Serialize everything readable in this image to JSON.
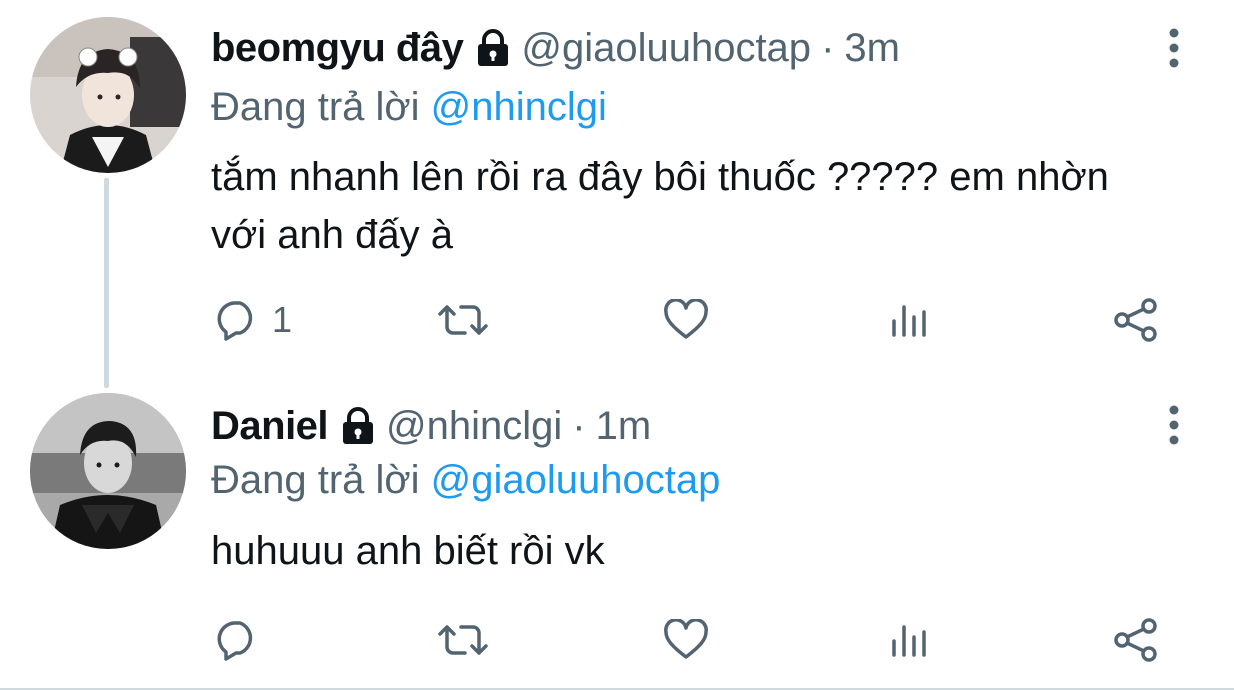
{
  "thread": [
    {
      "display_name": "beomgyu đây",
      "handle": "@giaoluuhoctap",
      "separator": "·",
      "time": "3m",
      "replying_prefix": "Đang trả lời",
      "replying_to": "@nhinclgi",
      "text": "tắm nhanh lên rồi ra đây bôi thuốc ????? em nhờn với anh đấy à",
      "reply_count": "1",
      "avatar_colors": {
        "bg": "#d9d4d0",
        "hair": "#2b2424",
        "face": "#f1e4da",
        "shirt": "#1b1b1b"
      }
    },
    {
      "display_name": "Daniel",
      "handle": "@nhinclgi",
      "separator": "·",
      "time": "1m",
      "replying_prefix": "Đang trả lời",
      "replying_to": "@giaoluuhoctap",
      "text": "huhuuu anh biết rồi vk",
      "reply_count": "",
      "avatar_colors": {
        "bg": "#8e8e8e",
        "hair": "#1c1c1c",
        "face": "#d8d8d8",
        "shirt": "#151515"
      }
    }
  ],
  "colors": {
    "text_primary": "#0f1419",
    "text_secondary": "#536471",
    "link": "#1d9bf0",
    "divider": "#cfd9de"
  },
  "icons": [
    "lock-icon",
    "more-vertical-icon",
    "reply-icon",
    "retweet-icon",
    "heart-icon",
    "views-icon",
    "share-icon"
  ]
}
